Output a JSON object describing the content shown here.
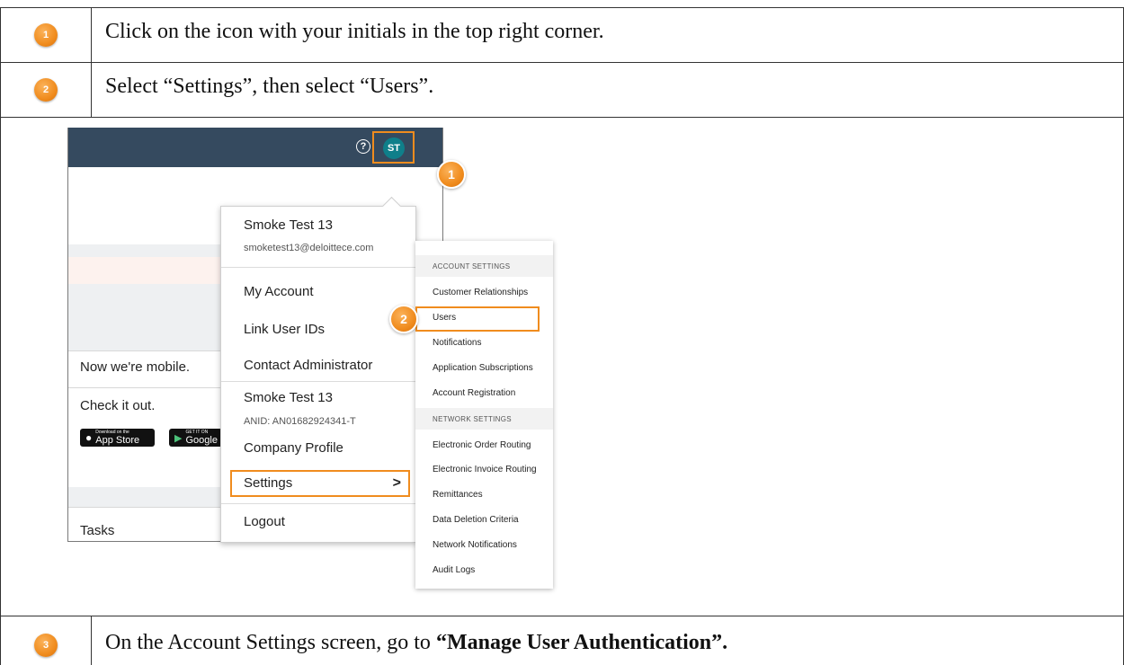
{
  "steps": [
    {
      "number": "1",
      "text": "Click on the icon with your initials in the top right corner."
    },
    {
      "number": "2",
      "text": "Select “Settings”, then select “Users”."
    },
    {
      "number": "3",
      "text_prefix": "On the Account Settings screen, go to ",
      "text_bold": "“Manage User Authentication”."
    }
  ],
  "screenshot": {
    "header": {
      "help_icon": "?",
      "avatar_initials": "ST"
    },
    "background": {
      "mobile_title": "Now we're mobile.",
      "mobile_cta": "Check it out.",
      "app_store_small": "Download on the",
      "app_store": "App Store",
      "google_small": "GET IT ON",
      "google": "Google",
      "tasks": "Tasks"
    },
    "user_menu": {
      "name": "Smoke Test 13",
      "email": "smoketest13@deloittece.com",
      "my_account": "My Account",
      "link_user_ids": "Link User IDs",
      "contact_admin": "Contact Administrator",
      "company_name": "Smoke Test 13",
      "anid": "ANID: AN01682924341-T",
      "company_profile": "Company Profile",
      "settings": "Settings",
      "logout": "Logout"
    },
    "settings_menu": {
      "account_header": "ACCOUNT SETTINGS",
      "account_items": [
        "Customer Relationships",
        "Users",
        "Notifications",
        "Application Subscriptions",
        "Account Registration"
      ],
      "network_header": "NETWORK SETTINGS",
      "network_items": [
        "Electronic Order Routing",
        "Electronic Invoice Routing",
        "Remittances",
        "Data Deletion Criteria",
        "Network Notifications",
        "Audit Logs"
      ]
    },
    "callouts": [
      "1",
      "2"
    ]
  },
  "colors": {
    "accent_orange": "#f08c1e",
    "header_navy": "#354a5f",
    "avatar_teal": "#0f7f8a"
  }
}
